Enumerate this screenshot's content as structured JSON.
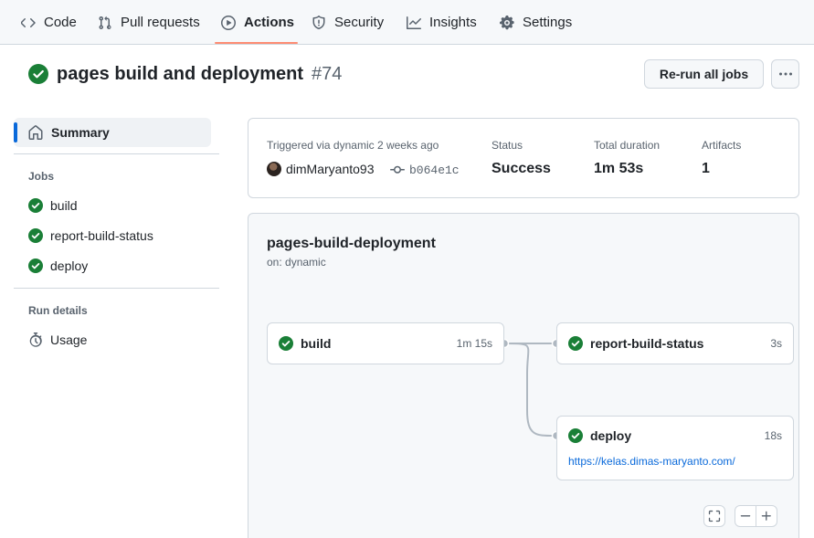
{
  "nav": {
    "tabs": [
      {
        "label": "Code",
        "icon": "code-icon"
      },
      {
        "label": "Pull requests",
        "icon": "git-pull-request-icon"
      },
      {
        "label": "Actions",
        "icon": "play-icon",
        "active": true
      },
      {
        "label": "Security",
        "icon": "shield-icon"
      },
      {
        "label": "Insights",
        "icon": "graph-icon"
      },
      {
        "label": "Settings",
        "icon": "gear-icon"
      }
    ]
  },
  "run": {
    "title": "pages build and deployment",
    "number": "#74",
    "status_icon": "check-circle-fill-icon",
    "rerun_label": "Re-run all jobs",
    "more_icon": "kebab-horizontal-icon"
  },
  "sidebar": {
    "summary_label": "Summary",
    "jobs_heading": "Jobs",
    "jobs": [
      {
        "label": "build",
        "status": "success"
      },
      {
        "label": "report-build-status",
        "status": "success"
      },
      {
        "label": "deploy",
        "status": "success"
      }
    ],
    "run_details_heading": "Run details",
    "usage_label": "Usage"
  },
  "summary": {
    "trigger_text": "Triggered via dynamic 2 weeks ago",
    "actor": "dimMaryanto93",
    "commit_sha": "b064e1c",
    "status_label": "Status",
    "status_value": "Success",
    "duration_label": "Total duration",
    "duration_value": "1m 53s",
    "artifacts_label": "Artifacts",
    "artifacts_value": "1"
  },
  "graph": {
    "workflow_name": "pages-build-deployment",
    "trigger": "on: dynamic",
    "jobs": [
      {
        "name": "build",
        "duration": "1m 15s"
      },
      {
        "name": "report-build-status",
        "duration": "3s"
      },
      {
        "name": "deploy",
        "duration": "18s",
        "link": "https://kelas.dimas-maryanto.com/"
      }
    ]
  },
  "colors": {
    "success_green": "#1a7f37",
    "accent_blue": "#0969da",
    "tab_underline": "#fd8c73"
  }
}
